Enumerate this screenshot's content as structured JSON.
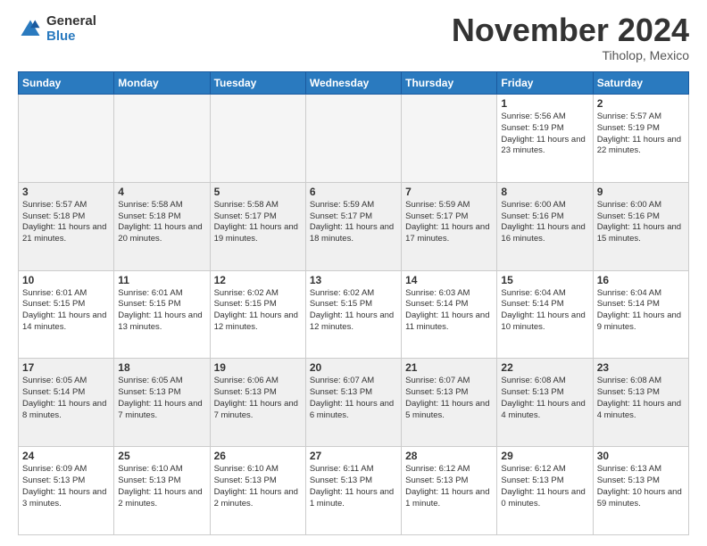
{
  "logo": {
    "general": "General",
    "blue": "Blue"
  },
  "title": "November 2024",
  "location": "Tiholop, Mexico",
  "days_of_week": [
    "Sunday",
    "Monday",
    "Tuesday",
    "Wednesday",
    "Thursday",
    "Friday",
    "Saturday"
  ],
  "weeks": [
    [
      {
        "day": "",
        "empty": true
      },
      {
        "day": "",
        "empty": true
      },
      {
        "day": "",
        "empty": true
      },
      {
        "day": "",
        "empty": true
      },
      {
        "day": "",
        "empty": true
      },
      {
        "day": "1",
        "sunrise": "5:56 AM",
        "sunset": "5:19 PM",
        "daylight": "11 hours and 23 minutes."
      },
      {
        "day": "2",
        "sunrise": "5:57 AM",
        "sunset": "5:19 PM",
        "daylight": "11 hours and 22 minutes."
      }
    ],
    [
      {
        "day": "3",
        "sunrise": "5:57 AM",
        "sunset": "5:18 PM",
        "daylight": "11 hours and 21 minutes."
      },
      {
        "day": "4",
        "sunrise": "5:58 AM",
        "sunset": "5:18 PM",
        "daylight": "11 hours and 20 minutes."
      },
      {
        "day": "5",
        "sunrise": "5:58 AM",
        "sunset": "5:17 PM",
        "daylight": "11 hours and 19 minutes."
      },
      {
        "day": "6",
        "sunrise": "5:59 AM",
        "sunset": "5:17 PM",
        "daylight": "11 hours and 18 minutes."
      },
      {
        "day": "7",
        "sunrise": "5:59 AM",
        "sunset": "5:17 PM",
        "daylight": "11 hours and 17 minutes."
      },
      {
        "day": "8",
        "sunrise": "6:00 AM",
        "sunset": "5:16 PM",
        "daylight": "11 hours and 16 minutes."
      },
      {
        "day": "9",
        "sunrise": "6:00 AM",
        "sunset": "5:16 PM",
        "daylight": "11 hours and 15 minutes."
      }
    ],
    [
      {
        "day": "10",
        "sunrise": "6:01 AM",
        "sunset": "5:15 PM",
        "daylight": "11 hours and 14 minutes."
      },
      {
        "day": "11",
        "sunrise": "6:01 AM",
        "sunset": "5:15 PM",
        "daylight": "11 hours and 13 minutes."
      },
      {
        "day": "12",
        "sunrise": "6:02 AM",
        "sunset": "5:15 PM",
        "daylight": "11 hours and 12 minutes."
      },
      {
        "day": "13",
        "sunrise": "6:02 AM",
        "sunset": "5:15 PM",
        "daylight": "11 hours and 12 minutes."
      },
      {
        "day": "14",
        "sunrise": "6:03 AM",
        "sunset": "5:14 PM",
        "daylight": "11 hours and 11 minutes."
      },
      {
        "day": "15",
        "sunrise": "6:04 AM",
        "sunset": "5:14 PM",
        "daylight": "11 hours and 10 minutes."
      },
      {
        "day": "16",
        "sunrise": "6:04 AM",
        "sunset": "5:14 PM",
        "daylight": "11 hours and 9 minutes."
      }
    ],
    [
      {
        "day": "17",
        "sunrise": "6:05 AM",
        "sunset": "5:14 PM",
        "daylight": "11 hours and 8 minutes."
      },
      {
        "day": "18",
        "sunrise": "6:05 AM",
        "sunset": "5:13 PM",
        "daylight": "11 hours and 7 minutes."
      },
      {
        "day": "19",
        "sunrise": "6:06 AM",
        "sunset": "5:13 PM",
        "daylight": "11 hours and 7 minutes."
      },
      {
        "day": "20",
        "sunrise": "6:07 AM",
        "sunset": "5:13 PM",
        "daylight": "11 hours and 6 minutes."
      },
      {
        "day": "21",
        "sunrise": "6:07 AM",
        "sunset": "5:13 PM",
        "daylight": "11 hours and 5 minutes."
      },
      {
        "day": "22",
        "sunrise": "6:08 AM",
        "sunset": "5:13 PM",
        "daylight": "11 hours and 4 minutes."
      },
      {
        "day": "23",
        "sunrise": "6:08 AM",
        "sunset": "5:13 PM",
        "daylight": "11 hours and 4 minutes."
      }
    ],
    [
      {
        "day": "24",
        "sunrise": "6:09 AM",
        "sunset": "5:13 PM",
        "daylight": "11 hours and 3 minutes."
      },
      {
        "day": "25",
        "sunrise": "6:10 AM",
        "sunset": "5:13 PM",
        "daylight": "11 hours and 2 minutes."
      },
      {
        "day": "26",
        "sunrise": "6:10 AM",
        "sunset": "5:13 PM",
        "daylight": "11 hours and 2 minutes."
      },
      {
        "day": "27",
        "sunrise": "6:11 AM",
        "sunset": "5:13 PM",
        "daylight": "11 hours and 1 minute."
      },
      {
        "day": "28",
        "sunrise": "6:12 AM",
        "sunset": "5:13 PM",
        "daylight": "11 hours and 1 minute."
      },
      {
        "day": "29",
        "sunrise": "6:12 AM",
        "sunset": "5:13 PM",
        "daylight": "11 hours and 0 minutes."
      },
      {
        "day": "30",
        "sunrise": "6:13 AM",
        "sunset": "5:13 PM",
        "daylight": "10 hours and 59 minutes."
      }
    ]
  ]
}
